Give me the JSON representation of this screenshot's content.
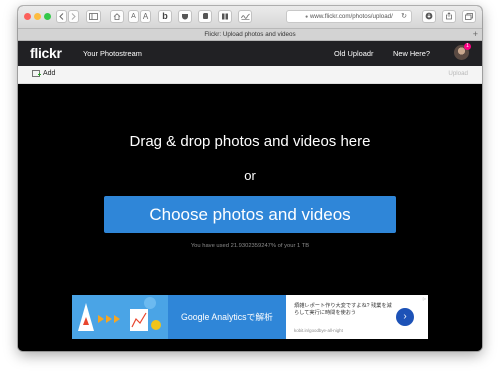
{
  "browser": {
    "url": "www.flickr.com/photos/upload/",
    "tab_title": "Flickr: Upload photos and videos",
    "reader_a_small": "A",
    "reader_a_large": "A",
    "new_tab_symbol": "+",
    "icons": [
      "sidebar-icon",
      "home-icon",
      "bing-icon",
      "pocket-icon",
      "evernote-icon",
      "bookmark-icon",
      "reload-icon",
      "download-icon",
      "share-icon",
      "tabs-icon"
    ]
  },
  "nav": {
    "logo": "flickr",
    "photostream": "Your Photostream",
    "old_uploadr": "Old Uploadr",
    "new_here": "New Here?",
    "notification_count": "1"
  },
  "addbar": {
    "add_label": "Add",
    "upload_label": "Upload"
  },
  "drop": {
    "title": "Drag & drop photos and videos here",
    "or": "or",
    "choose_button": "Choose photos and videos",
    "usage": "You have used 21.9302359247% of your 1 TB"
  },
  "ad": {
    "headline": "Google Analyticsで解析",
    "body": "煩雑レポート作り大変ですよね? 残業を減らして実行に時間を使おう",
    "source": "kobit.in/goodbye-all-night",
    "arrow": "›",
    "tag": "▷"
  },
  "colors": {
    "accent": "#2f86d8",
    "nav_bg": "#212124",
    "badge": "#ff0084"
  }
}
